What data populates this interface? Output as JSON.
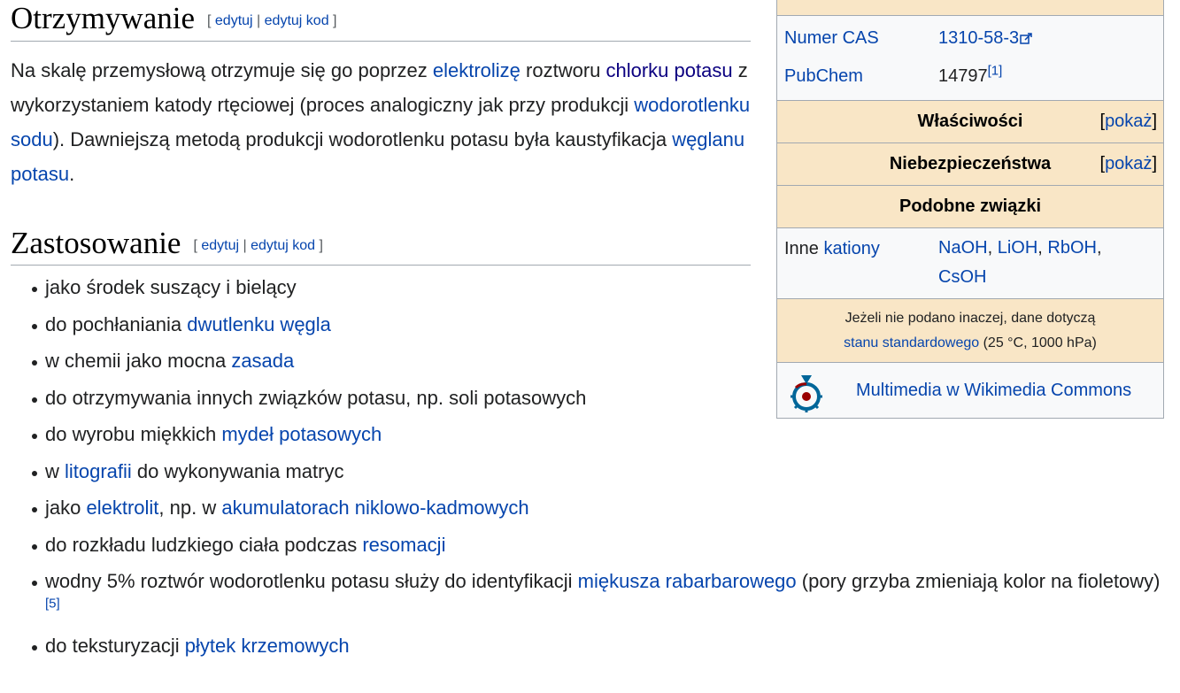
{
  "section1": {
    "title": "Otrzymywanie",
    "edit_open": "[",
    "edit": "edytuj",
    "sep": "|",
    "edit_code": "edytuj kod",
    "edit_close": "]"
  },
  "paragraph": {
    "t1": "Na skalę przemysłową otrzymuje się go poprzez ",
    "l1": "elektrolizę",
    "t2": " roztworu ",
    "l2": "chlorku potasu",
    "t3": " z wykorzystaniem katody rtęciowej (proces analogiczny jak przy produkcji ",
    "l3": "wodorotlenku sodu",
    "t4": "). Dawniejszą metodą produkcji wodorotlenku potasu była kaustyfikacja ",
    "l4": "węglanu potasu",
    "t5": "."
  },
  "section2": {
    "title": "Zastosowanie",
    "edit_open": "[",
    "edit": "edytuj",
    "sep": "|",
    "edit_code": "edytuj kod",
    "edit_close": "]"
  },
  "uses": [
    {
      "t1": "jako środek suszący i bielący"
    },
    {
      "t1": "do pochłaniania ",
      "l1": "dwutlenku węgla"
    },
    {
      "t1": "w chemii jako mocna ",
      "l1": "zasada"
    },
    {
      "t1": "do otrzymywania innych związków potasu, np. soli potasowych"
    },
    {
      "t1": "do wyrobu miękkich ",
      "l1": "mydeł potasowych"
    },
    {
      "t1": "w ",
      "l1": "litografii",
      "t2": " do wykonywania matryc"
    },
    {
      "t1": "jako ",
      "l1": "elektrolit",
      "t2": ", np. w ",
      "l2": "akumulatorach niklowo-kadmowych"
    },
    {
      "t1": "do rozkładu ludzkiego ciała podczas ",
      "l1": "resomacji"
    },
    {
      "t1": "wodny 5% roztwór wodorotlenku potasu służy do identyfikacji ",
      "l1": "miękusza rabarbarowego",
      "t2": " (pory grzyba zmieniają kolor na fioletowy)",
      "ref": "[5]"
    },
    {
      "t1": "do teksturyzacji ",
      "l1": "płytek krzemowych"
    }
  ],
  "infobox": {
    "cas_label": "Numer CAS",
    "cas_value": "1310-58-3",
    "pubchem_label": "PubChem",
    "pubchem_value": "14797",
    "pubchem_ref": "[1]",
    "properties": "Właściwości",
    "hazards": "Niebezpieczeństwa",
    "show_open": "[",
    "show": "pokaż",
    "show_close": "]",
    "related": "Podobne związki",
    "other_label_plain": "Inne ",
    "other_label_link": "kationy",
    "other_values": [
      "NaOH",
      "LiOH",
      "RbOH",
      "CsOH"
    ],
    "note_line1": "Jeżeli nie podano inaczej, dane dotyczą",
    "note_link": "stanu standardowego",
    "note_tail": " (25 °C, 1000 hPa)",
    "commons": "Multimedia w Wikimedia Commons"
  },
  "colors": {
    "link": "#0645ad",
    "visited_link": "#0b0080",
    "infobox_header": "#f9e6c6",
    "infobox_bg": "#f8f9fa",
    "commons_red": "#990000",
    "commons_blue": "#006699"
  },
  "icons": [
    "external-link-icon",
    "wikimedia-commons-icon"
  ]
}
